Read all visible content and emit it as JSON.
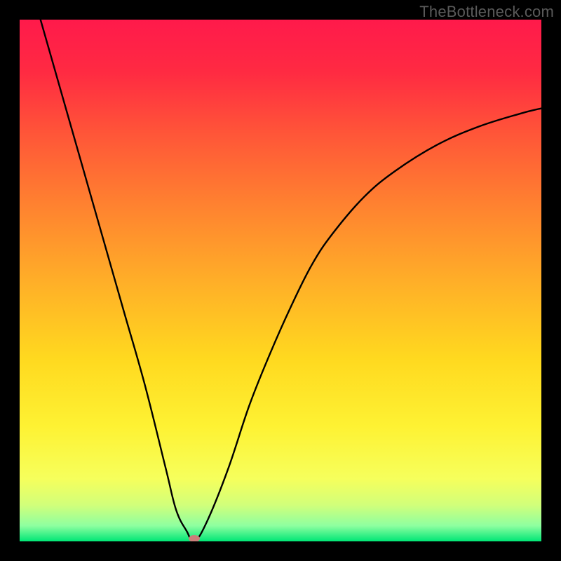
{
  "watermark": "TheBottleneck.com",
  "colors": {
    "frame": "#000000",
    "gradient_stops": [
      {
        "offset": 0.0,
        "color": "#ff1a4b"
      },
      {
        "offset": 0.1,
        "color": "#ff2a42"
      },
      {
        "offset": 0.22,
        "color": "#ff5638"
      },
      {
        "offset": 0.35,
        "color": "#ff8030"
      },
      {
        "offset": 0.5,
        "color": "#ffae28"
      },
      {
        "offset": 0.65,
        "color": "#ffd91f"
      },
      {
        "offset": 0.78,
        "color": "#fef233"
      },
      {
        "offset": 0.88,
        "color": "#f6ff5c"
      },
      {
        "offset": 0.93,
        "color": "#d2ff7a"
      },
      {
        "offset": 0.97,
        "color": "#8effa0"
      },
      {
        "offset": 1.0,
        "color": "#00e676"
      }
    ],
    "curve": "#000000",
    "dot": "#cb7e7a"
  },
  "chart_data": {
    "type": "line",
    "title": "",
    "xlabel": "",
    "ylabel": "",
    "xlim": [
      0,
      100
    ],
    "ylim": [
      0,
      100
    ],
    "grid": false,
    "series": [
      {
        "name": "bottleneck-curve",
        "x": [
          0,
          4,
          8,
          12,
          16,
          20,
          24,
          28,
          30,
          32,
          33.5,
          36,
          40,
          44,
          48,
          52,
          56,
          60,
          66,
          72,
          80,
          88,
          96,
          100
        ],
        "y": [
          114,
          100,
          86,
          72,
          58,
          44,
          30,
          14,
          6,
          2,
          0,
          4,
          14,
          26,
          36,
          45,
          53,
          59,
          66,
          71,
          76,
          79.5,
          82,
          83
        ]
      }
    ],
    "marker": {
      "x": 33.5,
      "y": 0.5,
      "shape": "ellipse"
    },
    "notes": "y values are percent of plot height from bottom; x is percent of plot width. Values estimated from pixels; chart has no axes/ticks."
  }
}
